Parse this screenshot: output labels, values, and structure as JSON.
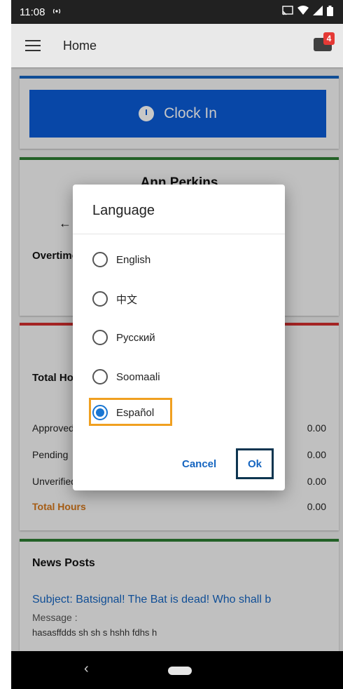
{
  "status_bar": {
    "time": "11:08"
  },
  "app_bar": {
    "title": "Home",
    "mail_badge": "4"
  },
  "clock_in": {
    "label": "Clock In"
  },
  "employee_card": {
    "name": "Ann Perkins",
    "overtime_label": "Overtime"
  },
  "hours_card": {
    "title": "Total Hours",
    "rows": [
      {
        "label": "Approved",
        "value": "0.00"
      },
      {
        "label": "Pending",
        "value": "0.00"
      },
      {
        "label": "Unverified",
        "value": "0.00"
      },
      {
        "label": "Total Hours",
        "value": "0.00"
      }
    ]
  },
  "news_card": {
    "title": "News Posts",
    "subject": "Subject: Batsignal! The Bat is dead! Who shall b",
    "message_label": "Message :",
    "message_body": "hasasffdds sh sh s hshh fdhs  h"
  },
  "dialog": {
    "title": "Language",
    "options": [
      {
        "label": "English",
        "selected": false
      },
      {
        "label": "中文",
        "selected": false
      },
      {
        "label": "Русский",
        "selected": false
      },
      {
        "label": "Soomaali",
        "selected": false
      },
      {
        "label": "Español",
        "selected": true
      }
    ],
    "cancel_label": "Cancel",
    "ok_label": "Ok"
  },
  "colors": {
    "accent_blue": "#0b5bd6",
    "highlight_orange": "#f0a020",
    "total_hours_orange": "#d4761a",
    "badge_red": "#e53935"
  }
}
